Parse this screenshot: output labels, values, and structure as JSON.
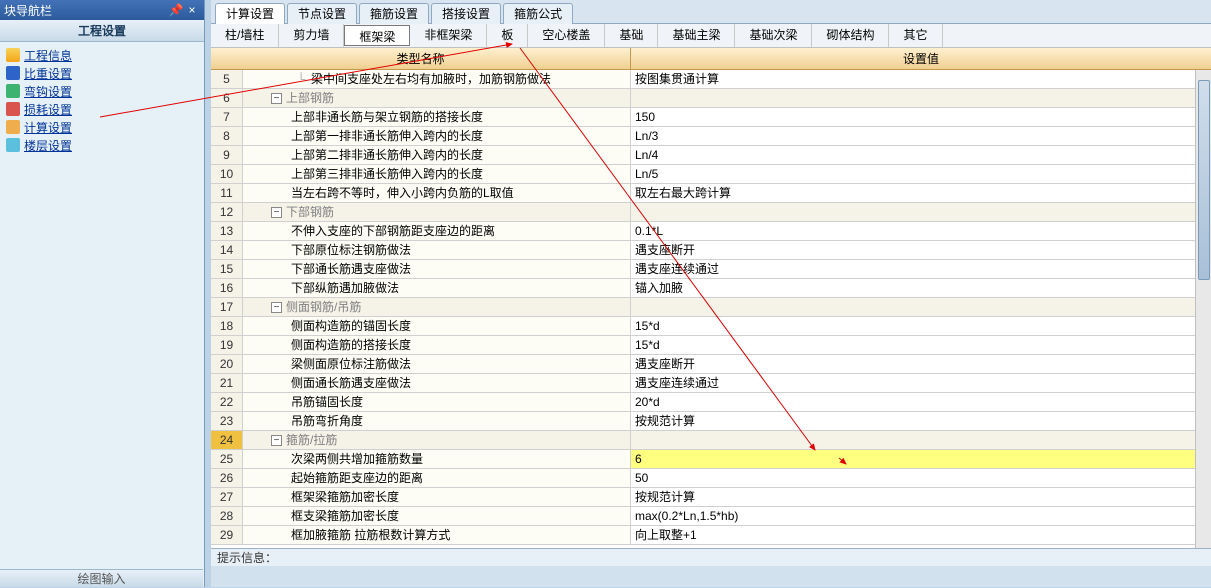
{
  "nav": {
    "title": "块导航栏",
    "panel_header": "工程设置",
    "items": [
      {
        "label": "工程信息",
        "icon": "ic-info"
      },
      {
        "label": "比重设置",
        "icon": "ic-weight"
      },
      {
        "label": "弯钩设置",
        "icon": "ic-hook"
      },
      {
        "label": "损耗设置",
        "icon": "ic-loss"
      },
      {
        "label": "计算设置",
        "icon": "ic-calc"
      },
      {
        "label": "楼层设置",
        "icon": "ic-floor"
      }
    ],
    "footer": "绘图输入"
  },
  "top_tabs": [
    "计算设置",
    "节点设置",
    "箍筋设置",
    "搭接设置",
    "箍筋公式"
  ],
  "top_tab_active": 0,
  "sub_tabs": [
    "柱/墙柱",
    "剪力墙",
    "框架梁",
    "非框架梁",
    "板",
    "空心楼盖",
    "基础",
    "基础主梁",
    "基础次梁",
    "砌体结构",
    "其它"
  ],
  "sub_tab_active": 2,
  "grid": {
    "header": {
      "col1": "类型名称",
      "col2": "设置值"
    },
    "rows": [
      {
        "num": "5",
        "indent": 2,
        "conn": "└",
        "label": "梁中间支座处左右均有加腋时，加筋钢筋做法",
        "value": "按图集贯通计算"
      },
      {
        "num": "6",
        "group": true,
        "indent": 1,
        "toggle": "-",
        "label": "上部钢筋",
        "value": ""
      },
      {
        "num": "7",
        "indent": 2,
        "label": "上部非通长筋与架立钢筋的搭接长度",
        "value": "150"
      },
      {
        "num": "8",
        "indent": 2,
        "label": "上部第一排非通长筋伸入跨内的长度",
        "value": "Ln/3"
      },
      {
        "num": "9",
        "indent": 2,
        "label": "上部第二排非通长筋伸入跨内的长度",
        "value": "Ln/4"
      },
      {
        "num": "10",
        "indent": 2,
        "label": "上部第三排非通长筋伸入跨内的长度",
        "value": "Ln/5"
      },
      {
        "num": "11",
        "indent": 2,
        "label": "当左右跨不等时，伸入小跨内负筋的L取值",
        "value": "取左右最大跨计算"
      },
      {
        "num": "12",
        "group": true,
        "indent": 1,
        "toggle": "-",
        "label": "下部钢筋",
        "value": ""
      },
      {
        "num": "13",
        "indent": 2,
        "label": "不伸入支座的下部钢筋距支座边的距离",
        "value": "0.1*L"
      },
      {
        "num": "14",
        "indent": 2,
        "label": "下部原位标注钢筋做法",
        "value": "遇支座断开"
      },
      {
        "num": "15",
        "indent": 2,
        "label": "下部通长筋遇支座做法",
        "value": "遇支座连续通过"
      },
      {
        "num": "16",
        "indent": 2,
        "label": "下部纵筋遇加腋做法",
        "value": "锚入加腋"
      },
      {
        "num": "17",
        "group": true,
        "indent": 1,
        "toggle": "-",
        "label": "侧面钢筋/吊筋",
        "value": ""
      },
      {
        "num": "18",
        "indent": 2,
        "label": "侧面构造筋的锚固长度",
        "value": "15*d"
      },
      {
        "num": "19",
        "indent": 2,
        "label": "侧面构造筋的搭接长度",
        "value": "15*d"
      },
      {
        "num": "20",
        "indent": 2,
        "label": "梁侧面原位标注筋做法",
        "value": "遇支座断开"
      },
      {
        "num": "21",
        "indent": 2,
        "label": "侧面通长筋遇支座做法",
        "value": "遇支座连续通过"
      },
      {
        "num": "22",
        "indent": 2,
        "label": "吊筋锚固长度",
        "value": "20*d"
      },
      {
        "num": "23",
        "indent": 2,
        "label": "吊筋弯折角度",
        "value": "按规范计算"
      },
      {
        "num": "24",
        "group": true,
        "sel": true,
        "indent": 1,
        "toggle": "-",
        "label": "箍筋/拉筋",
        "value": ""
      },
      {
        "num": "25",
        "hl": true,
        "indent": 2,
        "label": "次梁两侧共增加箍筋数量",
        "value": "6"
      },
      {
        "num": "26",
        "indent": 2,
        "label": "起始箍筋距支座边的距离",
        "value": "50"
      },
      {
        "num": "27",
        "indent": 2,
        "label": "框架梁箍筋加密长度",
        "value": "按规范计算"
      },
      {
        "num": "28",
        "indent": 2,
        "label": "框支梁箍筋加密长度",
        "value": "max(0.2*Ln,1.5*hb)"
      },
      {
        "num": "29",
        "indent": 2,
        "label": "框加腋箍筋   拉筋根数计算方式",
        "value": "向上取整+1"
      }
    ]
  },
  "status": "提示信息："
}
